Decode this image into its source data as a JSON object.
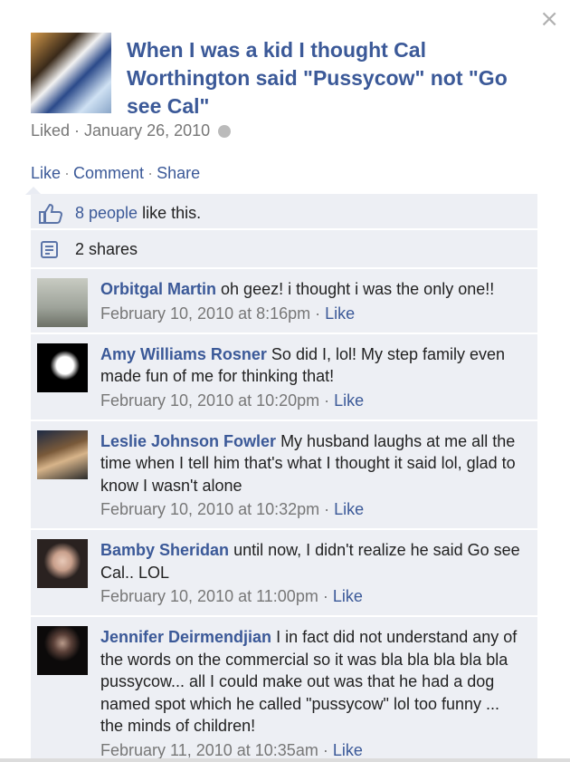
{
  "close_glyph": "×",
  "post": {
    "title": "When I was a kid I thought Cal Worthington said \"Pussycow\" not \"Go see Cal\"",
    "status": "Liked",
    "date": "January 26, 2010",
    "privacy_icon": "globe-icon"
  },
  "actions": {
    "like": "Like",
    "comment": "Comment",
    "share": "Share",
    "sep": "·"
  },
  "likes": {
    "count_link": "8 people",
    "suffix": " like this."
  },
  "shares": {
    "label": "2 shares"
  },
  "comments": [
    {
      "name": "Orbitgal Martin",
      "text": "oh geez! i thought i was the only one!!",
      "time": "February 10, 2010 at 8:16pm",
      "like": "Like"
    },
    {
      "name": "Amy Williams Rosner",
      "text": "So did I, lol! My step family even made fun of me for thinking that!",
      "time": "February 10, 2010 at 10:20pm",
      "like": "Like"
    },
    {
      "name": "Leslie Johnson Fowler",
      "text": "My husband laughs at me all the time when I tell him that's what I thought it said lol, glad to know I wasn't alone",
      "time": "February 10, 2010 at 10:32pm",
      "like": "Like"
    },
    {
      "name": "Bamby Sheridan",
      "text": "until now, I didn't realize he said Go see Cal.. LOL",
      "time": "February 10, 2010 at 11:00pm",
      "like": "Like"
    },
    {
      "name": "Jennifer Deirmendjian",
      "text": "I in fact did not understand any of the words on the commercial so it was bla bla bla bla bla pussycow... all I could make out was that he had a dog named spot which he called \"pussycow\" lol too funny ... the minds of children!",
      "time": "February 11, 2010 at 10:35am",
      "like": "Like"
    }
  ],
  "colors": {
    "link": "#3b5998",
    "row_bg": "#edeff4",
    "meta": "#777777"
  }
}
